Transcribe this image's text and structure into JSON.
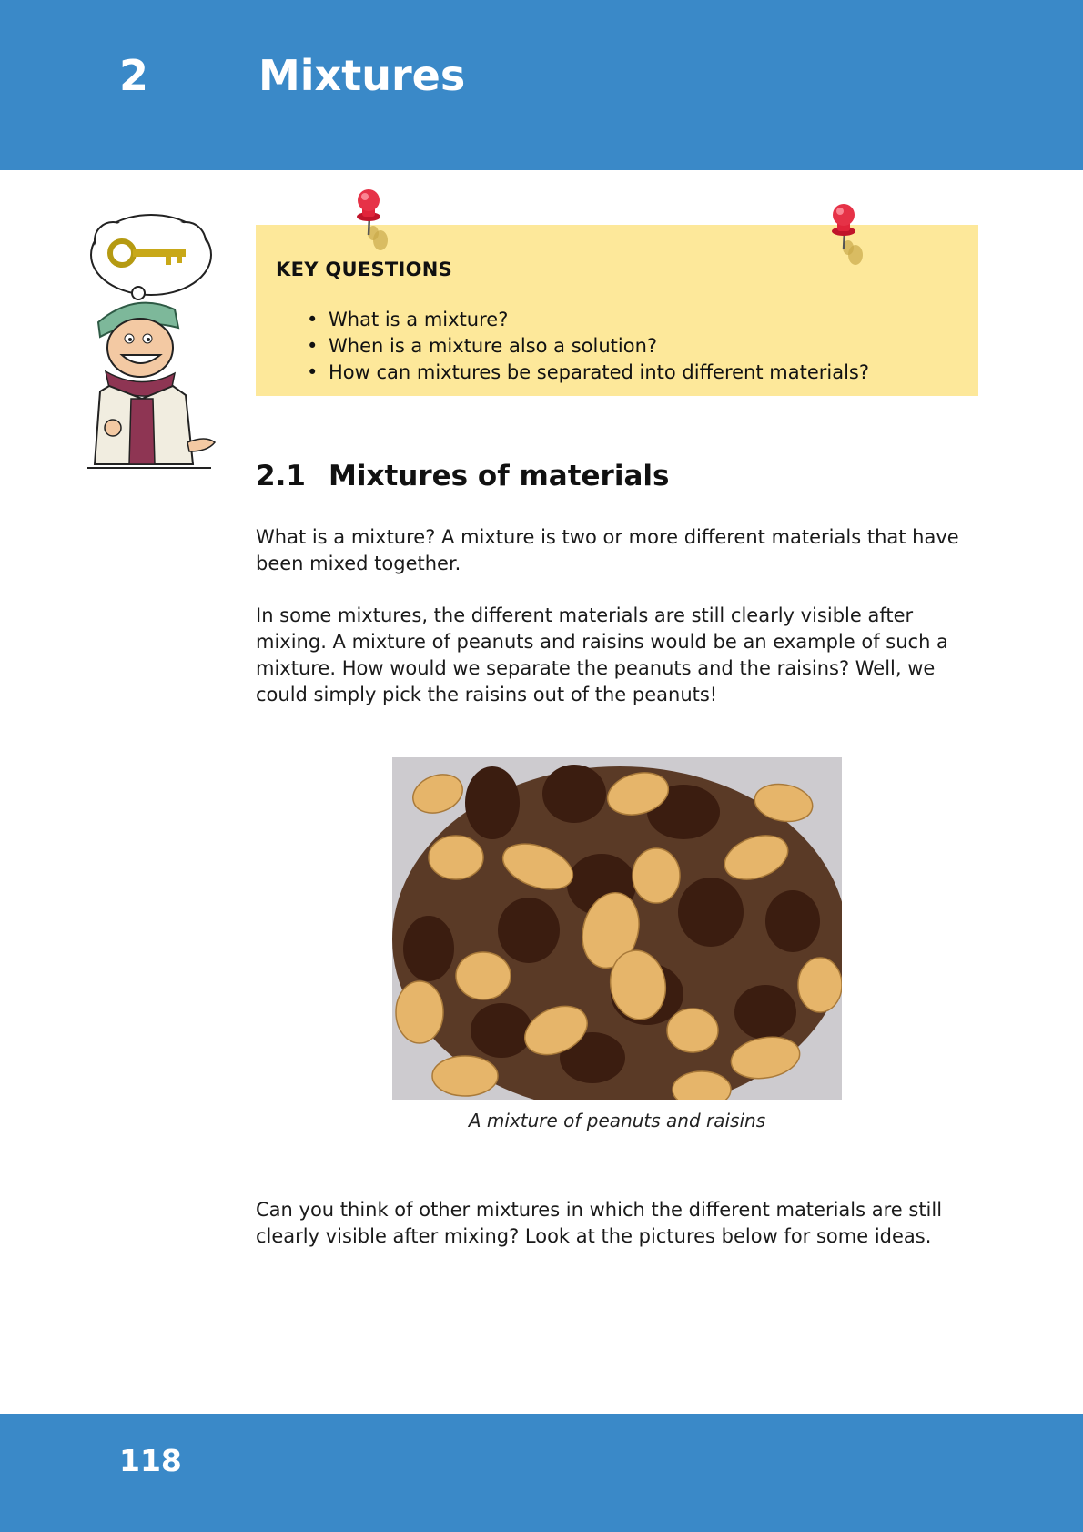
{
  "header": {
    "chapter_number": "2",
    "chapter_title": "Mixtures",
    "band_color": "#3a89c8"
  },
  "key_questions": {
    "heading": "KEY QUESTIONS",
    "items": [
      "What is a mixture?",
      "When is a mixture also a solution?",
      "How can mixtures be separated into different materials?"
    ],
    "box_color": "#fde89a"
  },
  "icons": {
    "mascot": "mascot-with-key-thought-bubble-icon",
    "pins": "red-pushpin-icon"
  },
  "section": {
    "number": "2.1",
    "title": "Mixtures of materials"
  },
  "body": {
    "paragraph_1": "What is a mixture? A mixture is two or more different materials that have been mixed together.",
    "paragraph_2": "In some mixtures, the different materials are still clearly visible after mixing. A mixture of peanuts and raisins would be an example of such a mixture. How would we separate the peanuts and the raisins? Well, we could simply pick the raisins out of the peanuts!",
    "paragraph_3": "Can you think of other mixtures in which the different materials are still clearly visible after mixing? Look at the pictures below for some ideas."
  },
  "figure": {
    "caption": "A mixture of peanuts and raisins"
  },
  "footer": {
    "page_number": "118"
  }
}
